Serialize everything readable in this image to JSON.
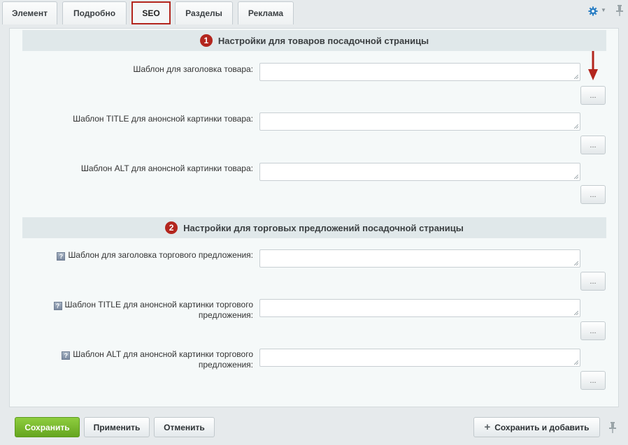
{
  "tabs": [
    {
      "label": "Элемент"
    },
    {
      "label": "Подробно"
    },
    {
      "label": "SEO"
    },
    {
      "label": "Разделы"
    },
    {
      "label": "Реклама"
    }
  ],
  "active_tab": "SEO",
  "sections": [
    {
      "number": "1",
      "title": "Настройки для товаров посадочной страницы",
      "rows": [
        {
          "label": "Шаблон для заголовка товара:",
          "value": "",
          "help": false
        },
        {
          "label": "Шаблон TITLE для анонсной картинки товара:",
          "value": "",
          "help": false
        },
        {
          "label": "Шаблон ALT для анонсной картинки товара:",
          "value": "",
          "help": false
        }
      ]
    },
    {
      "number": "2",
      "title": "Настройки для торговых предложений посадочной страницы",
      "rows": [
        {
          "label": "Шаблон для заголовка торгового предложения:",
          "value": "",
          "help": true
        },
        {
          "label_line1": "Шаблон TITLE для анонсной картинки торгового",
          "label_line2": "предложения:",
          "value": "",
          "help": true
        },
        {
          "label_line1": "Шаблон ALT для анонсной картинки торгового",
          "label_line2": "предложения:",
          "value": "",
          "help": true
        }
      ]
    }
  ],
  "insert_button_label": "...",
  "help_icon_glyph": "?",
  "footer": {
    "save": "Сохранить",
    "apply": "Применить",
    "cancel": "Отменить",
    "save_and_add": "Сохранить и добавить",
    "plus_glyph": "+"
  },
  "colors": {
    "accent_red": "#b3261e",
    "save_green": "#7bbd2f",
    "gear_blue": "#2b7fc4"
  },
  "icons": [
    "gear-icon",
    "pin-icon",
    "help-icon",
    "arrow-down-icon",
    "plus-icon"
  ]
}
